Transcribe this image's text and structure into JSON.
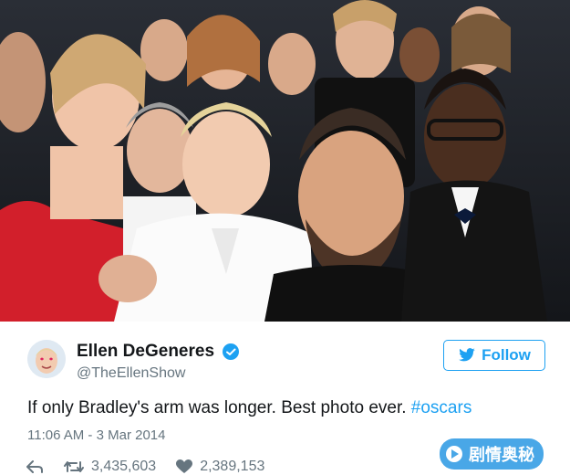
{
  "photo": {
    "description_icon": "group-selfie-photo"
  },
  "tweet": {
    "display_name": "Ellen DeGeneres",
    "handle": "@TheEllenShow",
    "follow_label": "Follow",
    "text_main": "If only Bradley's arm was longer. Best photo ever. ",
    "hashtag": "#oscars",
    "timestamp": "11:06 AM - 3 Mar 2014",
    "retweets": "3,435,603",
    "likes": "2,389,153"
  },
  "watermark": {
    "text": "剧情奥秘"
  },
  "colors": {
    "accent": "#1da1f2",
    "text": "#14171a",
    "muted": "#66757f"
  }
}
